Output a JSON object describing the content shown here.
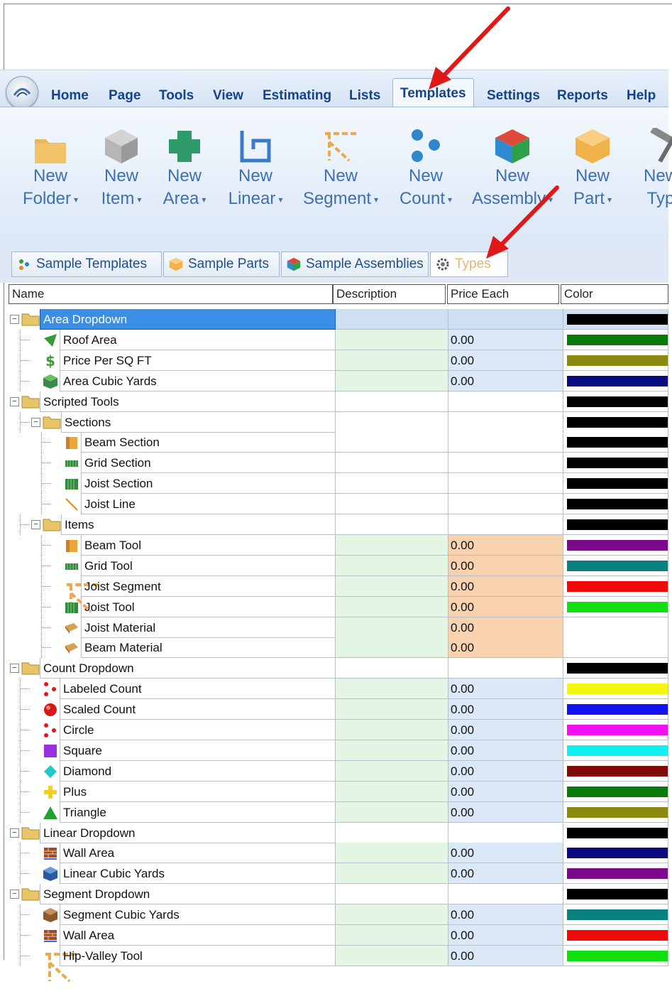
{
  "menu": {
    "tabs": [
      {
        "label": "Home"
      },
      {
        "label": "Page"
      },
      {
        "label": "Tools"
      },
      {
        "label": "View"
      },
      {
        "label": "Estimating"
      },
      {
        "label": "Lists"
      },
      {
        "label": "Templates",
        "active": true
      },
      {
        "label": "Settings"
      },
      {
        "label": "Reports"
      },
      {
        "label": "Help"
      }
    ]
  },
  "ribbon": {
    "buttons": [
      {
        "line1": "New",
        "line2": "Folder",
        "icon": "folder-icon"
      },
      {
        "line1": "New",
        "line2": "Item",
        "icon": "gray-cube-icon"
      },
      {
        "line1": "New",
        "line2": "Area",
        "icon": "area-shape-icon"
      },
      {
        "line1": "New",
        "line2": "Linear",
        "icon": "linear-icon"
      },
      {
        "line1": "New",
        "line2": "Segment",
        "icon": "segment-icon"
      },
      {
        "line1": "New",
        "line2": "Count",
        "icon": "count-dots-icon"
      },
      {
        "line1": "New",
        "line2": "Assembly",
        "icon": "assembly-cube-icon"
      },
      {
        "line1": "New",
        "line2": "Part",
        "icon": "part-cube-icon"
      },
      {
        "line1": "New",
        "line2": "Typ",
        "icon": "hammer-icon"
      }
    ]
  },
  "doc_tabs": [
    {
      "label": "Sample Templates",
      "icon": "templates-icon"
    },
    {
      "label": "Sample Parts",
      "icon": "part-cube-icon"
    },
    {
      "label": "Sample Assemblies",
      "icon": "assembly-cube-icon"
    },
    {
      "label": "Types",
      "icon": "gear-icon",
      "active": true
    }
  ],
  "grid": {
    "columns": [
      "Name",
      "Description",
      "Price Each",
      "Color"
    ],
    "rows": [
      {
        "name": "Area Dropdown",
        "level": 0,
        "folder": true,
        "selected": true,
        "price": "",
        "color": "#000000",
        "desc_bg": "#cfe0f3",
        "price_bg": "#cfe0f3"
      },
      {
        "name": "Roof Area",
        "level": 1,
        "icon": "roof-icon",
        "price": "0.00",
        "color": "#0a7a0a",
        "desc_bg": "#e3f5e3",
        "price_bg": "#dbe8f7"
      },
      {
        "name": "Price Per SQ FT",
        "level": 1,
        "icon": "dollar-icon",
        "price": "0.00",
        "color": "#8a8a10",
        "desc_bg": "#e3f5e3",
        "price_bg": "#dbe8f7"
      },
      {
        "name": "Area Cubic Yards",
        "level": 1,
        "icon": "cube-green-icon",
        "price": "0.00",
        "color": "#0a0a80",
        "desc_bg": "#e3f5e3",
        "price_bg": "#dbe8f7"
      },
      {
        "name": "Scripted Tools",
        "level": 0,
        "folder": true,
        "price": "",
        "color": "#000000",
        "desc_bg": "#ffffff",
        "price_bg": "#ffffff"
      },
      {
        "name": "Sections",
        "level": 1,
        "folder": true,
        "price": "",
        "color": "#000000",
        "desc_bg": "#ffffff",
        "price_bg": "#ffffff"
      },
      {
        "name": "Beam Section",
        "level": 2,
        "icon": "beam-icon",
        "price": "",
        "color": "#000000",
        "desc_bg": "#ffffff",
        "price_bg": "#ffffff"
      },
      {
        "name": "Grid Section",
        "level": 2,
        "icon": "grid-green-icon",
        "price": "",
        "color": "#000000",
        "desc_bg": "#ffffff",
        "price_bg": "#ffffff"
      },
      {
        "name": "Joist Section",
        "level": 2,
        "icon": "joist-icon",
        "price": "",
        "color": "#000000",
        "desc_bg": "#ffffff",
        "price_bg": "#ffffff"
      },
      {
        "name": "Joist Line",
        "level": 2,
        "icon": "line-icon",
        "price": "",
        "color": "#000000",
        "desc_bg": "#ffffff",
        "price_bg": "#ffffff"
      },
      {
        "name": "Items",
        "level": 1,
        "folder": true,
        "price": "",
        "color": "#000000",
        "desc_bg": "#ffffff",
        "price_bg": "#ffffff"
      },
      {
        "name": "Beam Tool",
        "level": 2,
        "icon": "beam-icon",
        "price": "0.00",
        "color": "#7a0a8a",
        "desc_bg": "#e3f5e3",
        "price_bg": "#f9d2b0"
      },
      {
        "name": "Grid Tool",
        "level": 2,
        "icon": "grid-green-icon",
        "price": "0.00",
        "color": "#0a8080",
        "desc_bg": "#e3f5e3",
        "price_bg": "#f9d2b0"
      },
      {
        "name": "Joist Segment",
        "level": 2,
        "icon": "segment-icon",
        "price": "0.00",
        "color": "#f00a0a",
        "desc_bg": "#e3f5e3",
        "price_bg": "#f9d2b0"
      },
      {
        "name": "Joist Tool",
        "level": 2,
        "icon": "joist-icon",
        "price": "0.00",
        "color": "#10e010",
        "desc_bg": "#e3f5e3",
        "price_bg": "#f9d2b0"
      },
      {
        "name": "Joist Material",
        "level": 2,
        "icon": "material-icon",
        "price": "0.00",
        "color": "",
        "desc_bg": "#e3f5e3",
        "price_bg": "#f9d2b0"
      },
      {
        "name": "Beam Material",
        "level": 2,
        "icon": "material-icon",
        "price": "0.00",
        "color": "",
        "desc_bg": "#e3f5e3",
        "price_bg": "#f9d2b0"
      },
      {
        "name": "Count Dropdown",
        "level": 0,
        "folder": true,
        "price": "",
        "color": "#000000",
        "desc_bg": "#ffffff",
        "price_bg": "#ffffff"
      },
      {
        "name": "Labeled Count",
        "level": 1,
        "icon": "dots-icon",
        "price": "0.00",
        "color": "#f5f510",
        "desc_bg": "#e3f5e3",
        "price_bg": "#dbe8f7"
      },
      {
        "name": "Scaled Count",
        "level": 1,
        "icon": "red-ball-icon",
        "price": "0.00",
        "color": "#1010f0",
        "desc_bg": "#e3f5e3",
        "price_bg": "#dbe8f7"
      },
      {
        "name": "Circle",
        "level": 1,
        "icon": "dots-icon",
        "price": "0.00",
        "color": "#f010f0",
        "desc_bg": "#e3f5e3",
        "price_bg": "#dbe8f7"
      },
      {
        "name": "Square",
        "level": 1,
        "icon": "square-icon",
        "price": "0.00",
        "color": "#10f0f0",
        "desc_bg": "#e3f5e3",
        "price_bg": "#dbe8f7"
      },
      {
        "name": "Diamond",
        "level": 1,
        "icon": "diamond-icon",
        "price": "0.00",
        "color": "#800a0a",
        "desc_bg": "#e3f5e3",
        "price_bg": "#dbe8f7"
      },
      {
        "name": "Plus",
        "level": 1,
        "icon": "plus-icon",
        "price": "0.00",
        "color": "#0a7a0a",
        "desc_bg": "#e3f5e3",
        "price_bg": "#dbe8f7"
      },
      {
        "name": "Triangle",
        "level": 1,
        "icon": "triangle-icon",
        "price": "0.00",
        "color": "#8a8a10",
        "desc_bg": "#e3f5e3",
        "price_bg": "#dbe8f7"
      },
      {
        "name": "Linear Dropdown",
        "level": 0,
        "folder": true,
        "price": "",
        "color": "#000000",
        "desc_bg": "#ffffff",
        "price_bg": "#ffffff"
      },
      {
        "name": "Wall Area",
        "level": 1,
        "icon": "wall-icon",
        "price": "0.00",
        "color": "#0a0a80",
        "desc_bg": "#e3f5e3",
        "price_bg": "#dbe8f7"
      },
      {
        "name": "Linear Cubic Yards",
        "level": 1,
        "icon": "cube-blue-icon",
        "price": "0.00",
        "color": "#7a0a8a",
        "desc_bg": "#e3f5e3",
        "price_bg": "#dbe8f7"
      },
      {
        "name": "Segment Dropdown",
        "level": 0,
        "folder": true,
        "price": "",
        "color": "#000000",
        "desc_bg": "#ffffff",
        "price_bg": "#ffffff"
      },
      {
        "name": "Segment Cubic Yards",
        "level": 1,
        "icon": "cube-brown-icon",
        "price": "0.00",
        "color": "#0a8080",
        "desc_bg": "#e3f5e3",
        "price_bg": "#dbe8f7"
      },
      {
        "name": "Wall Area",
        "level": 1,
        "icon": "wall-icon",
        "price": "0.00",
        "color": "#f00a0a",
        "desc_bg": "#e3f5e3",
        "price_bg": "#dbe8f7"
      },
      {
        "name": "Hip-Valley Tool",
        "level": 1,
        "icon": "segment-icon",
        "price": "0.00",
        "color": "#10e010",
        "desc_bg": "#e3f5e3",
        "price_bg": "#dbe8f7"
      }
    ]
  }
}
